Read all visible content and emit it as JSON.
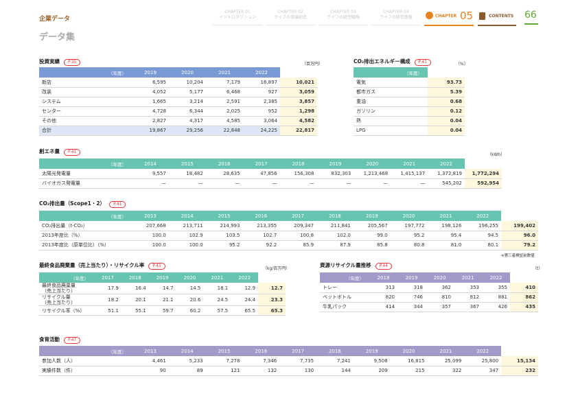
{
  "header": {
    "category": "企業データ",
    "page_title": "データ集",
    "page_number": "66",
    "chapters": [
      {
        "label": "CHAPTER 01",
        "sub": "イントロダクション"
      },
      {
        "label": "CHAPTER 02",
        "sub": "ライフの価値創造"
      },
      {
        "label": "CHAPTER 03",
        "sub": "ライフの経営戦略"
      },
      {
        "label": "CHAPTER 04",
        "sub": "ライフの経営基盤"
      }
    ],
    "current_chapter_label": "CHAPTER",
    "current_chapter_num": "05",
    "contents_label": "CONTENTS",
    "accent": "#e5821e"
  },
  "investment": {
    "title": "投資実績",
    "ref": "P.35",
    "unit": "（百万円）",
    "year_label": "（年度）",
    "years": [
      "2019",
      "2020",
      "2021",
      "2022",
      "2023"
    ],
    "rows": [
      [
        "新店",
        "6,595",
        "10,204",
        "7,179",
        "16,897",
        "10,021"
      ],
      [
        "改装",
        "4,052",
        "5,177",
        "6,468",
        "927",
        "3,059"
      ],
      [
        "システム",
        "1,665",
        "3,214",
        "2,591",
        "2,385",
        "3,857"
      ],
      [
        "センター",
        "4,728",
        "6,344",
        "2,025",
        "952",
        "1,298"
      ],
      [
        "その他",
        "2,827",
        "4,317",
        "4,585",
        "3,064",
        "4,582"
      ],
      [
        "合計",
        "19,867",
        "29,256",
        "22,848",
        "24,225",
        "22,817"
      ]
    ]
  },
  "co2energy": {
    "title": "CO₂排出エネルギー構成",
    "ref": "P.41",
    "unit": "（%）",
    "year_label": "（年度）",
    "years": [
      "2023"
    ],
    "rows": [
      [
        "電気",
        "93.73"
      ],
      [
        "都市ガス",
        "5.39"
      ],
      [
        "重油",
        "0.68"
      ],
      [
        "ガソリン",
        "0.12"
      ],
      [
        "熱",
        "0.04"
      ],
      [
        "LPG",
        "0.04"
      ]
    ]
  },
  "energy": {
    "title": "創エネ量",
    "ref": "P.41",
    "unit": "（kWh）",
    "year_label": "（年度）",
    "years": [
      "2014",
      "2015",
      "2016",
      "2017",
      "2018",
      "2019",
      "2020",
      "2021",
      "2022",
      "2023"
    ],
    "rows": [
      [
        "太陽光発電量",
        "9,557",
        "18,482",
        "28,635",
        "47,856",
        "156,308",
        "832,303",
        "1,213,468",
        "1,415,137",
        "1,372,819",
        "1,772,294"
      ],
      [
        "バイオガス発電量",
        "—",
        "—",
        "—",
        "—",
        "—",
        "—",
        "—",
        "—",
        "545,202",
        "592,954"
      ]
    ]
  },
  "co2": {
    "title": "CO₂排出量（Scope1・2）",
    "ref": "P.41",
    "year_label": "（年度）",
    "years": [
      "2013",
      "2014",
      "2015",
      "2016",
      "2017",
      "2018",
      "2019",
      "2020",
      "2021",
      "2022",
      "2023"
    ],
    "rows": [
      [
        "CO₂排出量（t-CO₂）",
        "207,668",
        "213,711",
        "214,993",
        "213,355",
        "209,347",
        "211,841",
        "205,567",
        "197,772",
        "198,126",
        "196,255",
        "199,402"
      ],
      [
        "2013年度比（%）",
        "100.0",
        "102.9",
        "103.5",
        "102.7",
        "100.8",
        "102.0",
        "99.0",
        "95.2",
        "95.4",
        "94.5",
        "96.0"
      ],
      [
        "2013年度比（原単位比）（%）",
        "100.0",
        "100.0",
        "95.2",
        "92.2",
        "85.9",
        "87.9",
        "85.8",
        "80.8",
        "81.0",
        "80.1",
        "79.2"
      ]
    ],
    "note": "※第三者検証前数値"
  },
  "foodwaste": {
    "title": "最終食品廃棄量（売上当たり）・リサイクル率",
    "ref": "P.43",
    "unit": "（kg/百万円）",
    "year_label": "（年度）",
    "years": [
      "2017",
      "2018",
      "2019",
      "2020",
      "2021",
      "2022",
      "2023"
    ],
    "rows": [
      [
        "最終食品廃棄量\n（売上当たり）",
        "17.9",
        "16.4",
        "14.7",
        "14.5",
        "18.1",
        "12.9",
        "12.7"
      ],
      [
        "リサイクル量\n（売上当たり）",
        "18.2",
        "20.1",
        "21.1",
        "20.6",
        "24.5",
        "24.4",
        "23.3"
      ],
      [
        "リサイクル率（%）",
        "51.1",
        "55.1",
        "59.7",
        "60.2",
        "57.5",
        "65.5",
        "65.3"
      ]
    ]
  },
  "recycle": {
    "title": "資源リサイクル量推移",
    "ref": "P.44",
    "unit": "（t）",
    "year_label": "（年度）",
    "years": [
      "2018",
      "2019",
      "2020",
      "2021",
      "2022",
      "2023"
    ],
    "rows": [
      [
        "トレー",
        "313",
        "318",
        "362",
        "353",
        "355",
        "410"
      ],
      [
        "ペットボトル",
        "820",
        "746",
        "810",
        "812",
        "881",
        "862"
      ],
      [
        "牛乳パック",
        "414",
        "344",
        "357",
        "367",
        "426",
        "435"
      ]
    ]
  },
  "foodedu": {
    "title": "食育活動",
    "ref": "P.47",
    "year_label": "（年度）",
    "years": [
      "2013",
      "2014",
      "2015",
      "2016",
      "2017",
      "2018",
      "2019",
      "2020",
      "2021",
      "2022",
      "2023"
    ],
    "rows": [
      [
        "参加人数（人）",
        "4,461",
        "5,233",
        "7,278",
        "7,346",
        "7,735",
        "7,241",
        "9,508",
        "16,815",
        "25,099",
        "25,800",
        "15,134"
      ],
      [
        "実績件数（件）",
        "90",
        "89",
        "121",
        "132",
        "130",
        "144",
        "209",
        "215",
        "322",
        "347",
        "232"
      ]
    ]
  }
}
